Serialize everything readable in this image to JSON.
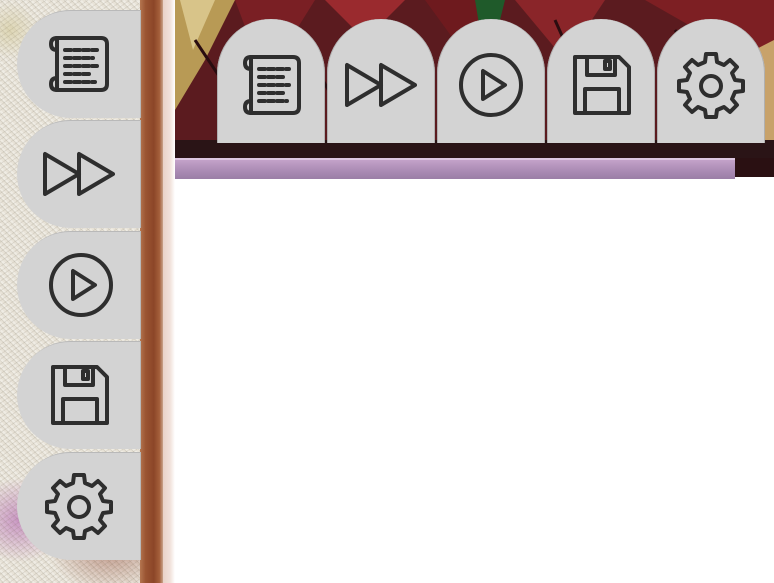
{
  "colors": {
    "button_bg": "#d3d3d3",
    "icon": "#2e2e2e",
    "divider": "#8c4628",
    "purple_bar": "#a98ab3",
    "scene_red": "#5b1b1f"
  },
  "side_menu": {
    "buttons": [
      {
        "icon": "scroll-log-icon"
      },
      {
        "icon": "fast-forward-icon"
      },
      {
        "icon": "auto-play-icon"
      },
      {
        "icon": "save-icon"
      },
      {
        "icon": "settings-gear-icon"
      }
    ]
  },
  "top_menu": {
    "buttons": [
      {
        "icon": "scroll-log-icon"
      },
      {
        "icon": "fast-forward-icon"
      },
      {
        "icon": "auto-play-icon"
      },
      {
        "icon": "save-icon"
      },
      {
        "icon": "settings-gear-icon"
      }
    ]
  }
}
